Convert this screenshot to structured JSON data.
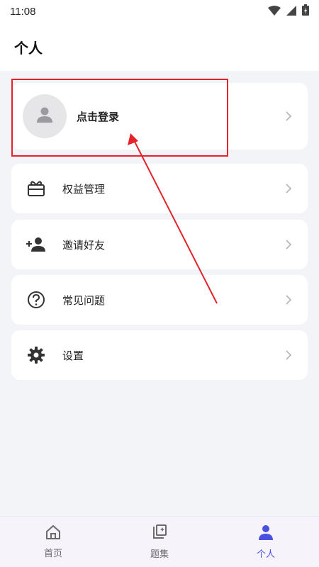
{
  "status_bar": {
    "time": "11:08"
  },
  "header": {
    "title": "个人"
  },
  "profile": {
    "login_label": "点击登录"
  },
  "menu": [
    {
      "label": "权益管理",
      "icon": "gift-card-icon"
    },
    {
      "label": "邀请好友",
      "icon": "add-user-icon"
    },
    {
      "label": "常见问题",
      "icon": "help-circle-icon"
    },
    {
      "label": "设置",
      "icon": "gear-icon"
    }
  ],
  "bottom_nav": [
    {
      "label": "首页",
      "icon": "home-icon"
    },
    {
      "label": "题集",
      "icon": "question-set-icon"
    },
    {
      "label": "个人",
      "icon": "person-icon"
    }
  ],
  "colors": {
    "accent": "#4a50e0",
    "annotation_red": "#e5232a",
    "background": "#f3f4f8"
  }
}
